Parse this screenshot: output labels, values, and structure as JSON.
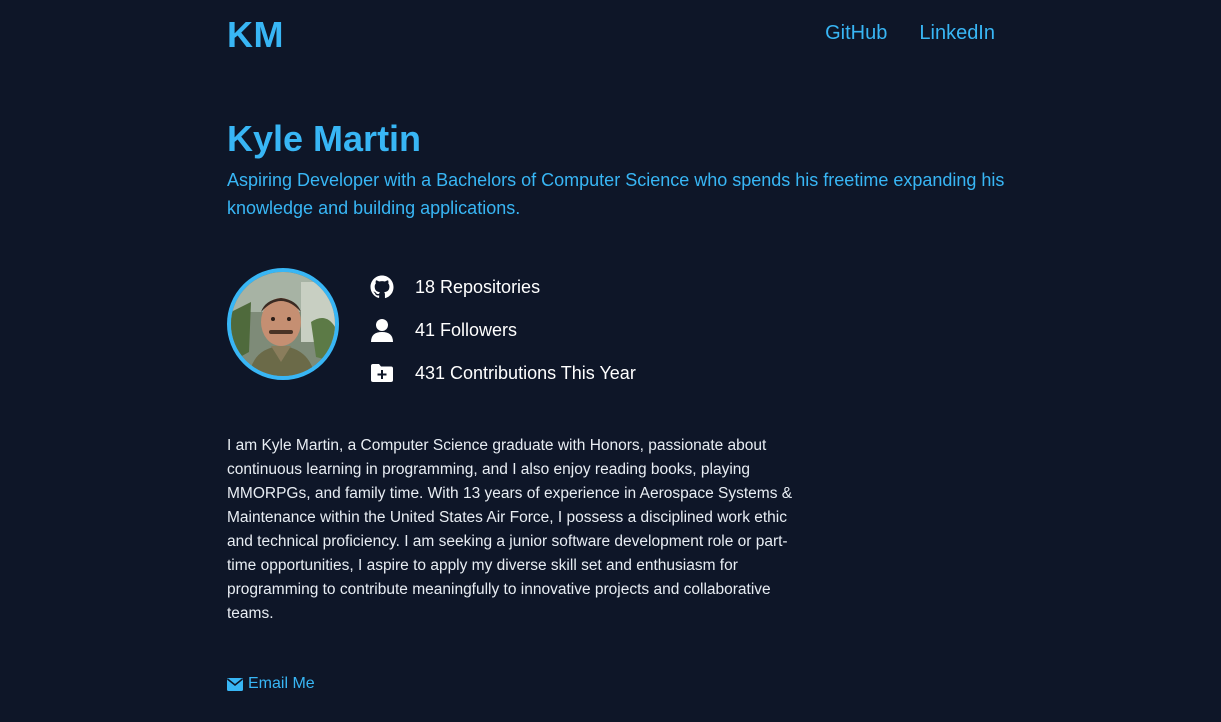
{
  "header": {
    "logo": "KM",
    "nav": [
      {
        "label": "GitHub"
      },
      {
        "label": "LinkedIn"
      }
    ]
  },
  "hero": {
    "name": "Kyle Martin",
    "tagline": "Aspiring Developer with a Bachelors of Computer Science who spends his freetime expanding his knowledge and building applications."
  },
  "profile": {
    "avatar_icon": "profile-photo",
    "stats": [
      {
        "icon": "github-icon",
        "label": "18 Repositories"
      },
      {
        "icon": "user-icon",
        "label": "41 Followers"
      },
      {
        "icon": "folder-plus-icon",
        "label": "431 Contributions This Year"
      }
    ]
  },
  "bio": {
    "text": "I am Kyle Martin, a Computer Science graduate with Honors, passionate about continuous learning in programming, and I also enjoy reading books, playing MMORPGs, and family time. With 13 years of experience in Aerospace Systems & Maintenance within the United States Air Force, I possess a disciplined work ethic and technical proficiency. I am seeking a junior software development role or part-time opportunities, I aspire to apply my diverse skill set and enthusiasm for programming to contribute meaningfully to innovative projects and collaborative teams."
  },
  "contact": {
    "email_label": "Email Me",
    "email_icon": "envelope-icon"
  },
  "colors": {
    "background": "#0e1628",
    "accent": "#38b6f5",
    "text": "#ffffff"
  }
}
